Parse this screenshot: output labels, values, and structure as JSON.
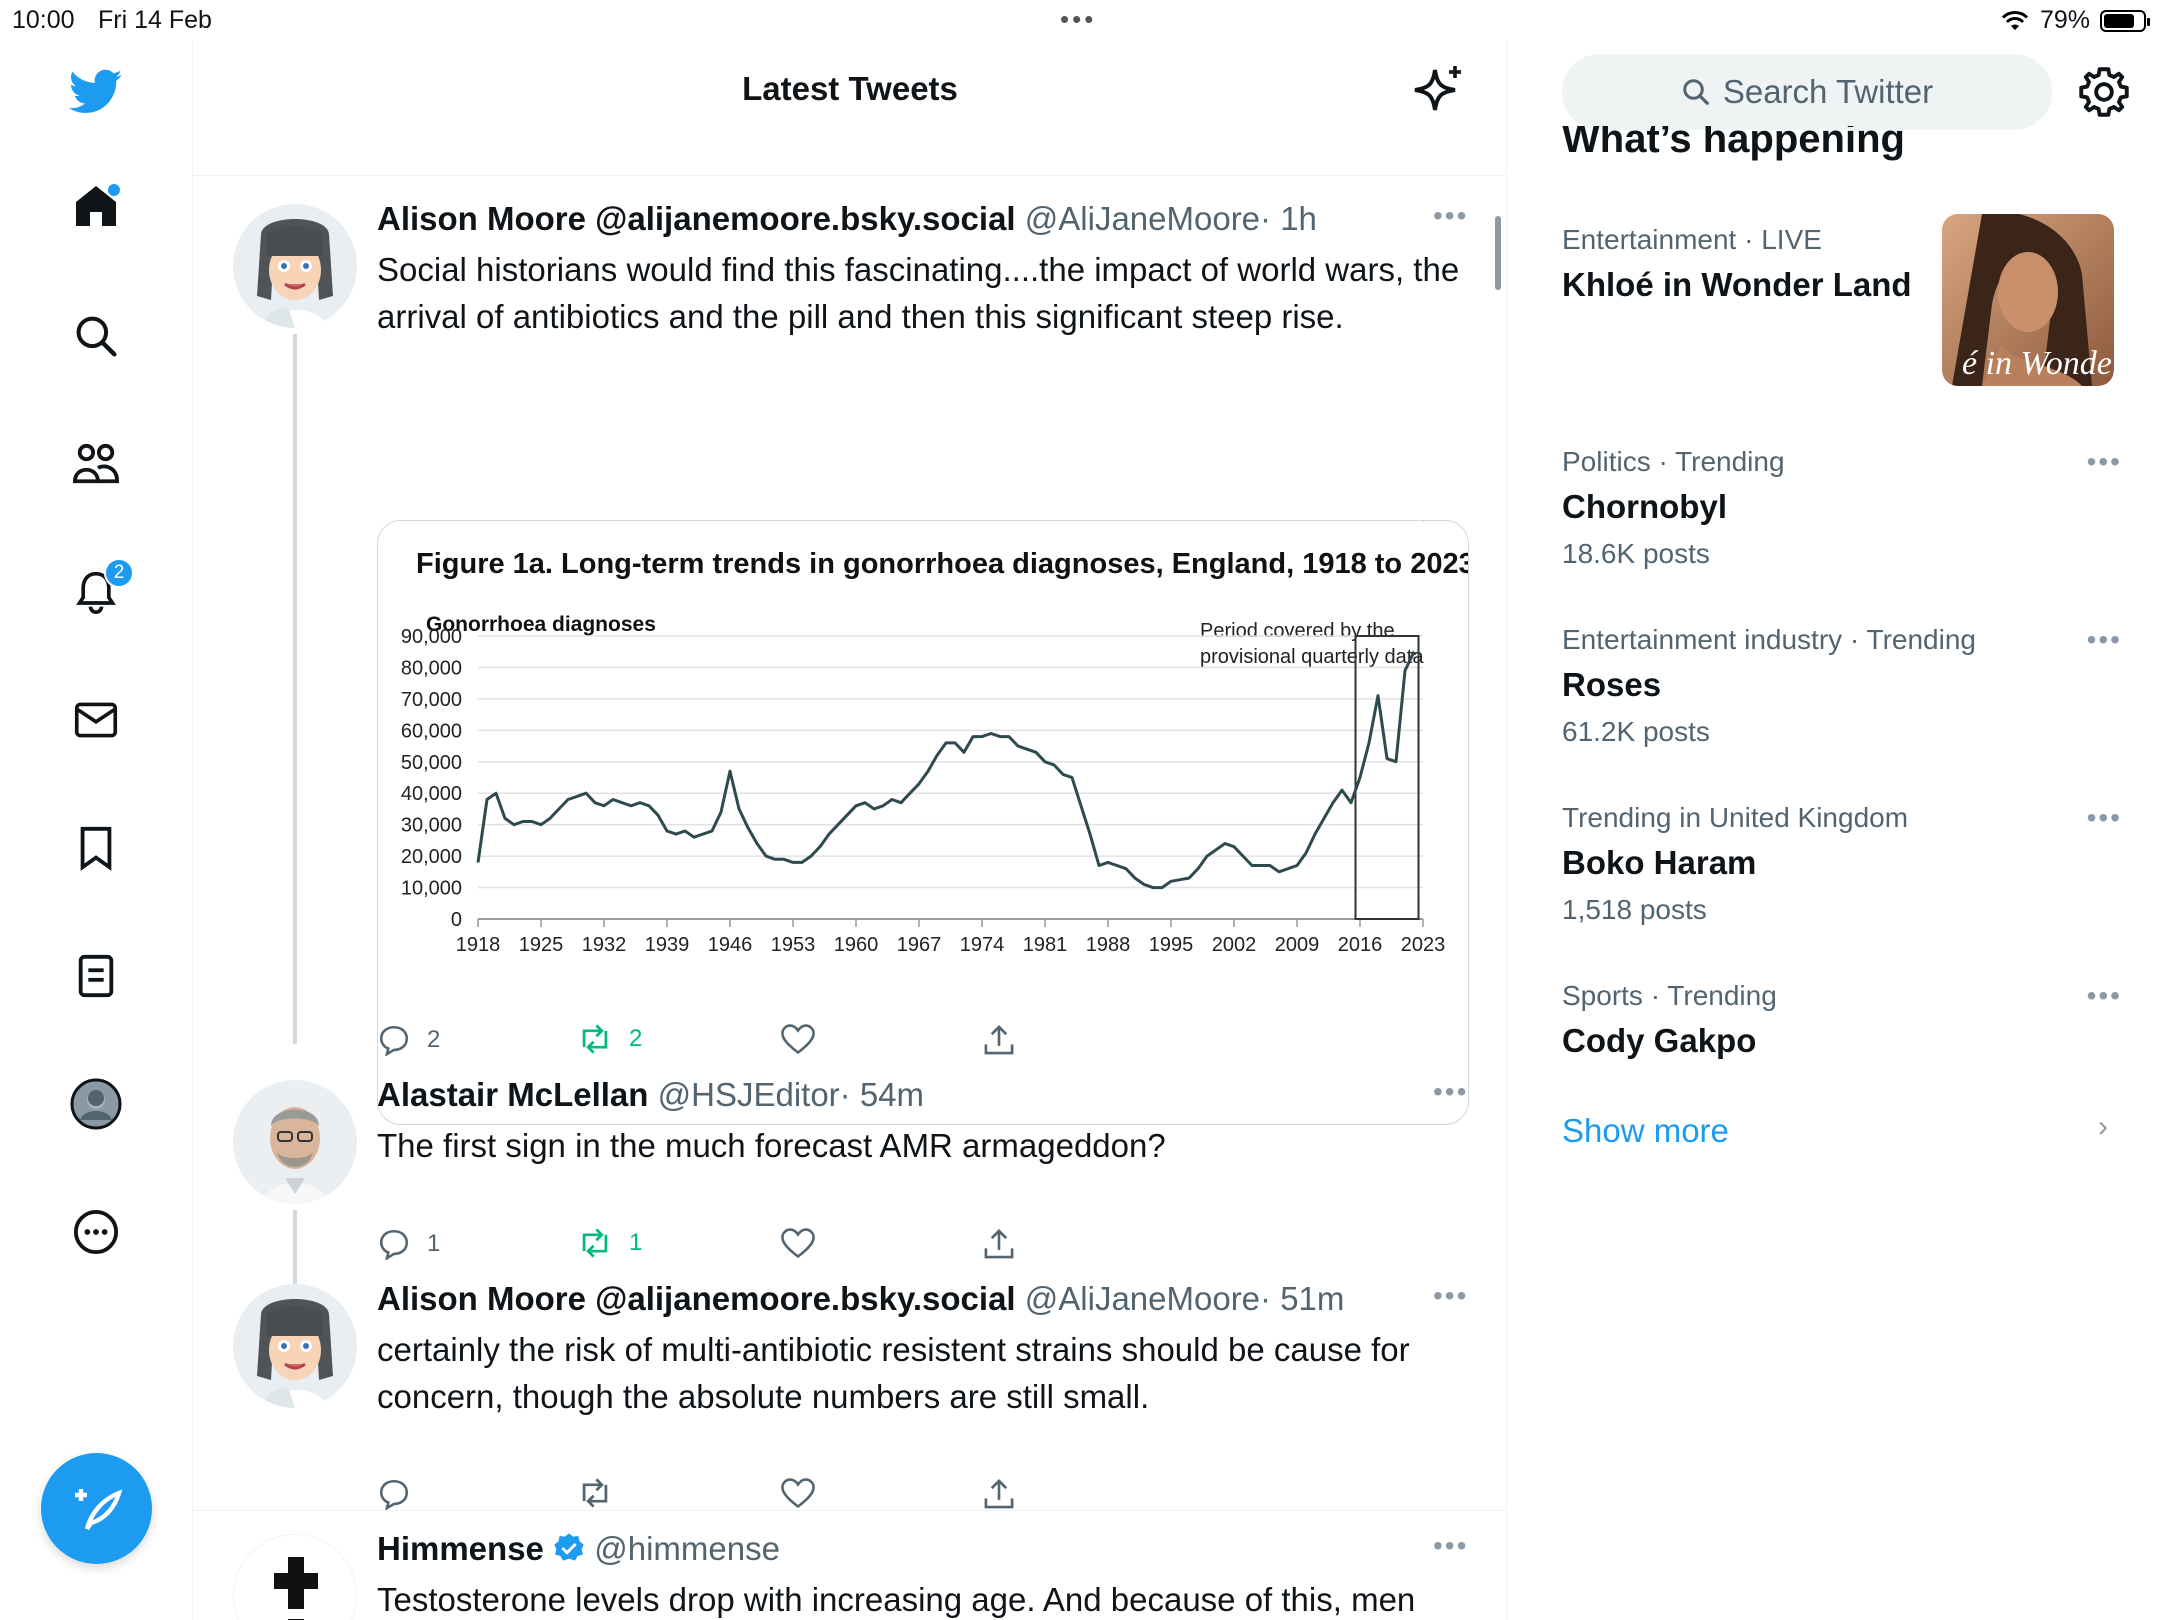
{
  "status_bar": {
    "time": "10:00",
    "date": "Fri 14 Feb",
    "battery": "79%",
    "battery_level": 0.79
  },
  "nav": {
    "notifications_badge": "2"
  },
  "header": {
    "title": "Latest Tweets"
  },
  "tweets": [
    {
      "name": "Alison Moore @alijanemoore.bsky.social",
      "handle": "@AliJaneMoore",
      "time": "· 1h",
      "text": "Social historians would find this fascinating....the impact of world wars, the arrival of antibiotics and the pill and then this significant steep rise.",
      "replies": "2",
      "retweets": "2"
    },
    {
      "name": "Alastair McLellan",
      "handle": "@HSJEditor",
      "time": "· 54m",
      "text": "The first sign in the much forecast AMR armageddon?",
      "replies": "1",
      "retweets": "1"
    },
    {
      "name": "Alison Moore @alijanemoore.bsky.social",
      "handle": "@AliJaneMoore",
      "time": "· 51m",
      "text": "certainly the risk of multi-antibiotic resistent strains should be cause for concern, though the absolute numbers are still small.",
      "replies": "",
      "retweets": ""
    },
    {
      "name": "Himmense",
      "handle": "@himmense",
      "time": "",
      "text": "Testosterone levels drop with increasing age. And because of this, men",
      "verified": true
    }
  ],
  "chart_data": {
    "type": "line",
    "title": "Figure 1a. Long-term trends in gonorrhoea diagnoses, England, 1918 to 2023",
    "ylabel": "Gonorrhoea diagnoses",
    "annotation": "Period covered by the provisional quarterly data",
    "annotation_lines": [
      "Period covered by the",
      "provisional quarterly data"
    ],
    "ylim": [
      0,
      90000
    ],
    "yticks": [
      "0",
      "10,000",
      "20,000",
      "30,000",
      "40,000",
      "50,000",
      "60,000",
      "70,000",
      "80,000",
      "90,000"
    ],
    "xticks": [
      "1918",
      "1925",
      "1932",
      "1939",
      "1946",
      "1953",
      "1960",
      "1967",
      "1974",
      "1981",
      "1988",
      "1995",
      "2002",
      "2009",
      "2016",
      "2023"
    ],
    "xlim": [
      1918,
      2023
    ],
    "highlight_range": [
      2015.5,
      2022.5
    ],
    "x": [
      1918,
      1919,
      1920,
      1921,
      1922,
      1923,
      1924,
      1925,
      1926,
      1927,
      1928,
      1929,
      1930,
      1931,
      1932,
      1933,
      1934,
      1935,
      1936,
      1937,
      1938,
      1939,
      1940,
      1941,
      1942,
      1943,
      1944,
      1945,
      1946,
      1947,
      1948,
      1949,
      1950,
      1951,
      1952,
      1953,
      1954,
      1955,
      1956,
      1957,
      1958,
      1959,
      1960,
      1961,
      1962,
      1963,
      1964,
      1965,
      1966,
      1967,
      1968,
      1969,
      1970,
      1971,
      1972,
      1973,
      1974,
      1975,
      1976,
      1977,
      1978,
      1979,
      1980,
      1981,
      1982,
      1983,
      1984,
      1985,
      1986,
      1987,
      1988,
      1989,
      1990,
      1991,
      1992,
      1993,
      1994,
      1995,
      1996,
      1997,
      1998,
      1999,
      2000,
      2001,
      2002,
      2003,
      2004,
      2005,
      2006,
      2007,
      2008,
      2009,
      2010,
      2011,
      2012,
      2013,
      2014,
      2015,
      2016,
      2017,
      2018,
      2019,
      2020,
      2021,
      2022,
      2023
    ],
    "series": [
      {
        "values": [
          18000,
          38000,
          40000,
          32000,
          30000,
          31000,
          31000,
          30000,
          32000,
          35000,
          38000,
          39000,
          40000,
          37000,
          36000,
          38000,
          37000,
          36000,
          37000,
          36000,
          33000,
          28000,
          27000,
          28000,
          26000,
          27000,
          28000,
          34000,
          47000,
          35000,
          29000,
          24000,
          20000,
          19000,
          19000,
          18000,
          18000,
          20000,
          23000,
          27000,
          30000,
          33000,
          36000,
          37000,
          35000,
          36000,
          38000,
          37000,
          40000,
          43000,
          47000,
          52000,
          56000,
          56000,
          53000,
          58000,
          58000,
          59000,
          58000,
          58000,
          55000,
          54000,
          53000,
          50000,
          49000,
          46000,
          45000,
          36000,
          27000,
          17000,
          18000,
          17000,
          16000,
          13000,
          11000,
          10000,
          10000,
          12000,
          12500,
          13000,
          16000,
          20000,
          22000,
          24000,
          23000,
          20000,
          17000,
          17000,
          17000,
          15000,
          16000,
          17000,
          21000,
          27000,
          32000,
          37000,
          41000,
          37000,
          45000,
          56000,
          71000,
          51000,
          50000,
          79000,
          85000
        ]
      }
    ]
  },
  "right": {
    "search_placeholder": "Search Twitter",
    "whats_happening": "What’s happening",
    "trends": [
      {
        "meta_prefix": "Entertainment",
        "meta_suffix": " · LIVE",
        "topic": "Khloé in Wonder Land",
        "count": "",
        "image_caption": "é in Wonder L"
      },
      {
        "meta_prefix": "Politics · Trending",
        "meta_suffix": "",
        "topic": "Chornobyl",
        "count": "18.6K posts"
      },
      {
        "meta_prefix": "Entertainment industry · Trending",
        "meta_suffix": "",
        "topic": "Roses",
        "count": "61.2K posts"
      },
      {
        "meta_prefix": "Trending in United Kingdom",
        "meta_suffix": "",
        "topic": "Boko Haram",
        "count": "1,518 posts"
      },
      {
        "meta_prefix": "Sports · Trending",
        "meta_suffix": "",
        "topic": "Cody Gakpo",
        "count": ""
      }
    ],
    "show_more": "Show more"
  },
  "colors": {
    "accent": "#1d9bf0",
    "retweet": "#00ba7c",
    "secondary_text": "#536471",
    "chart_line": "#2e4a4e"
  }
}
